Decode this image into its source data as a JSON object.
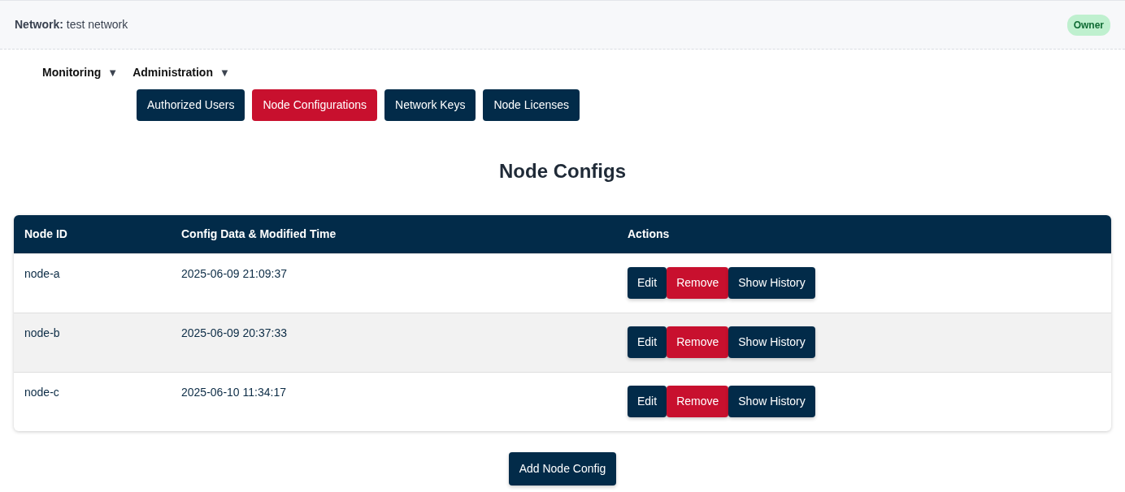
{
  "header": {
    "label": "Network:",
    "value": "test network",
    "role_badge": "Owner"
  },
  "menus": [
    {
      "label": "Monitoring",
      "caret": "▼"
    },
    {
      "label": "Administration",
      "caret": "▼"
    }
  ],
  "tabs": [
    {
      "label": "Authorized Users",
      "selected": false
    },
    {
      "label": "Node Configurations",
      "selected": true
    },
    {
      "label": "Network Keys",
      "selected": false
    },
    {
      "label": "Node Licenses",
      "selected": false
    }
  ],
  "title": "Node Configs",
  "table": {
    "columns": [
      "Node ID",
      "Config Data & Modified Time",
      "Actions"
    ],
    "rows": [
      {
        "node_id": "node-a",
        "modified": "2025-06-09 21:09:37",
        "actions": [
          {
            "label": "Edit",
            "kind": "primary"
          },
          {
            "label": "Remove",
            "kind": "danger"
          },
          {
            "label": "Show History",
            "kind": "primary"
          }
        ]
      },
      {
        "node_id": "node-b",
        "modified": "2025-06-09 20:37:33",
        "actions": [
          {
            "label": "Edit",
            "kind": "primary"
          },
          {
            "label": "Remove",
            "kind": "danger"
          },
          {
            "label": "Show History",
            "kind": "primary"
          }
        ]
      },
      {
        "node_id": "node-c",
        "modified": "2025-06-10 11:34:17",
        "actions": [
          {
            "label": "Edit",
            "kind": "primary"
          },
          {
            "label": "Remove",
            "kind": "danger"
          },
          {
            "label": "Show History",
            "kind": "primary"
          }
        ]
      }
    ]
  },
  "add_button": "Add Node Config"
}
